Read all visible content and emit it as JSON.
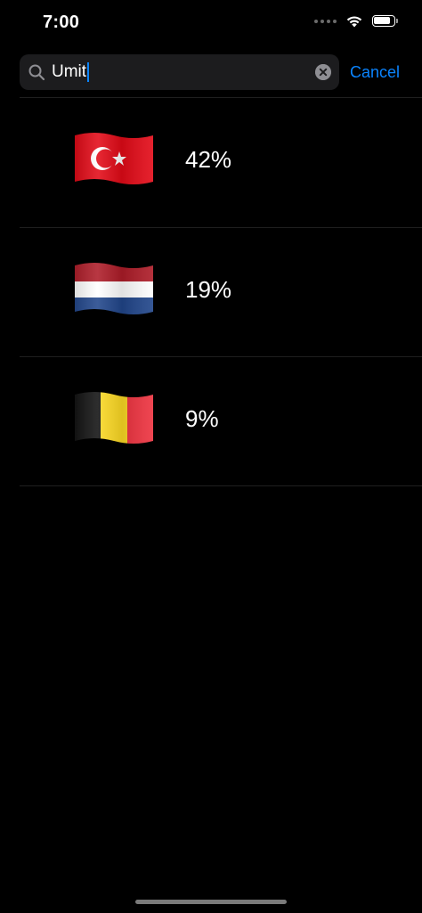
{
  "status_bar": {
    "time": "7:00",
    "battery_level": 0.85,
    "icons": [
      "signal-dots-icon",
      "wifi-icon",
      "battery-icon"
    ]
  },
  "search": {
    "value": "Umit",
    "icon": "search-icon",
    "clear_icon": "clear-icon",
    "cancel_label": "Cancel"
  },
  "results": [
    {
      "flag": "turkey-flag-icon",
      "value": "42%",
      "colors": [
        "#e30a17",
        "#ffffff"
      ]
    },
    {
      "flag": "netherlands-flag-icon",
      "value": "19%",
      "colors": [
        "#ae1c28",
        "#ffffff",
        "#21468b"
      ]
    },
    {
      "flag": "belgium-flag-icon",
      "value": "9%",
      "colors": [
        "#000000",
        "#fdda24",
        "#ef3340"
      ]
    }
  ],
  "colors": {
    "accent": "#0a84ff",
    "background": "#000000",
    "field": "#1c1c1e"
  }
}
